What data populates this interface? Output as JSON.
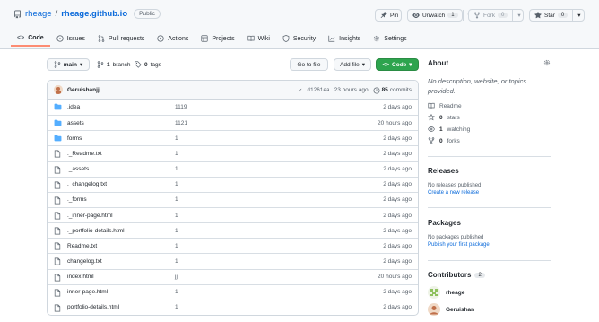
{
  "repo": {
    "owner": "rheage",
    "separator": "/",
    "name": "rheage.github.io",
    "visibility": "Public"
  },
  "actions": {
    "pin_label": "Pin",
    "unwatch_label": "Unwatch",
    "unwatch_count": "1",
    "fork_label": "Fork",
    "fork_count": "0",
    "star_label": "Star",
    "star_count": "0"
  },
  "tabs": [
    {
      "label": "Code",
      "icon": "code-icon"
    },
    {
      "label": "Issues",
      "icon": "issue-icon"
    },
    {
      "label": "Pull requests",
      "icon": "pull-request-icon"
    },
    {
      "label": "Actions",
      "icon": "play-icon"
    },
    {
      "label": "Projects",
      "icon": "table-icon"
    },
    {
      "label": "Wiki",
      "icon": "book-icon"
    },
    {
      "label": "Security",
      "icon": "shield-icon"
    },
    {
      "label": "Insights",
      "icon": "graph-icon"
    },
    {
      "label": "Settings",
      "icon": "gear-icon"
    }
  ],
  "toolbar": {
    "branch_button": "main",
    "branch_count": "1",
    "branch_label": "branch",
    "tag_count": "0",
    "tag_label": "tags",
    "go_to_file": "Go to file",
    "add_file": "Add file",
    "code_button": "Code"
  },
  "commit": {
    "user": "Geruishanjj",
    "sha": "d1261ea",
    "time": "23 hours ago",
    "commits_count": "85",
    "commits_label": "commits"
  },
  "files": [
    {
      "name": ".idea",
      "type": "folder",
      "message": "1119",
      "age": "2 days ago"
    },
    {
      "name": "assets",
      "type": "folder",
      "message": "1121",
      "age": "20 hours ago"
    },
    {
      "name": "forms",
      "type": "folder",
      "message": "1",
      "age": "2 days ago"
    },
    {
      "name": "._Readme.txt",
      "type": "file",
      "message": "1",
      "age": "2 days ago"
    },
    {
      "name": "._assets",
      "type": "file",
      "message": "1",
      "age": "2 days ago"
    },
    {
      "name": "._changelog.txt",
      "type": "file",
      "message": "1",
      "age": "2 days ago"
    },
    {
      "name": "._forms",
      "type": "file",
      "message": "1",
      "age": "2 days ago"
    },
    {
      "name": "._inner-page.html",
      "type": "file",
      "message": "1",
      "age": "2 days ago"
    },
    {
      "name": "._portfolio-details.html",
      "type": "file",
      "message": "1",
      "age": "2 days ago"
    },
    {
      "name": "Readme.txt",
      "type": "file",
      "message": "1",
      "age": "2 days ago"
    },
    {
      "name": "changelog.txt",
      "type": "file",
      "message": "1",
      "age": "2 days ago"
    },
    {
      "name": "index.html",
      "type": "file",
      "message": "jj",
      "age": "20 hours ago"
    },
    {
      "name": "inner-page.html",
      "type": "file",
      "message": "1",
      "age": "2 days ago"
    },
    {
      "name": "portfolio-details.html",
      "type": "file",
      "message": "1",
      "age": "2 days ago"
    }
  ],
  "about": {
    "heading": "About",
    "description": "No description, website, or topics provided.",
    "readme": "Readme",
    "stars_count": "0",
    "stars_label": "stars",
    "watching_count": "1",
    "watching_label": "watching",
    "forks_count": "0",
    "forks_label": "forks"
  },
  "releases": {
    "heading": "Releases",
    "empty": "No releases published",
    "create_link": "Create a new release"
  },
  "packages": {
    "heading": "Packages",
    "empty": "No packages published",
    "publish_link": "Publish your first package"
  },
  "contributors": {
    "heading": "Contributors",
    "count": "2",
    "list": [
      {
        "name": "rheage"
      },
      {
        "name": "Geruishan"
      }
    ]
  },
  "colors": {
    "link": "#0969da",
    "primary_button": "#2da44e",
    "folder_icon": "#54aeff",
    "active_tab_underline": "#fd8c73"
  }
}
